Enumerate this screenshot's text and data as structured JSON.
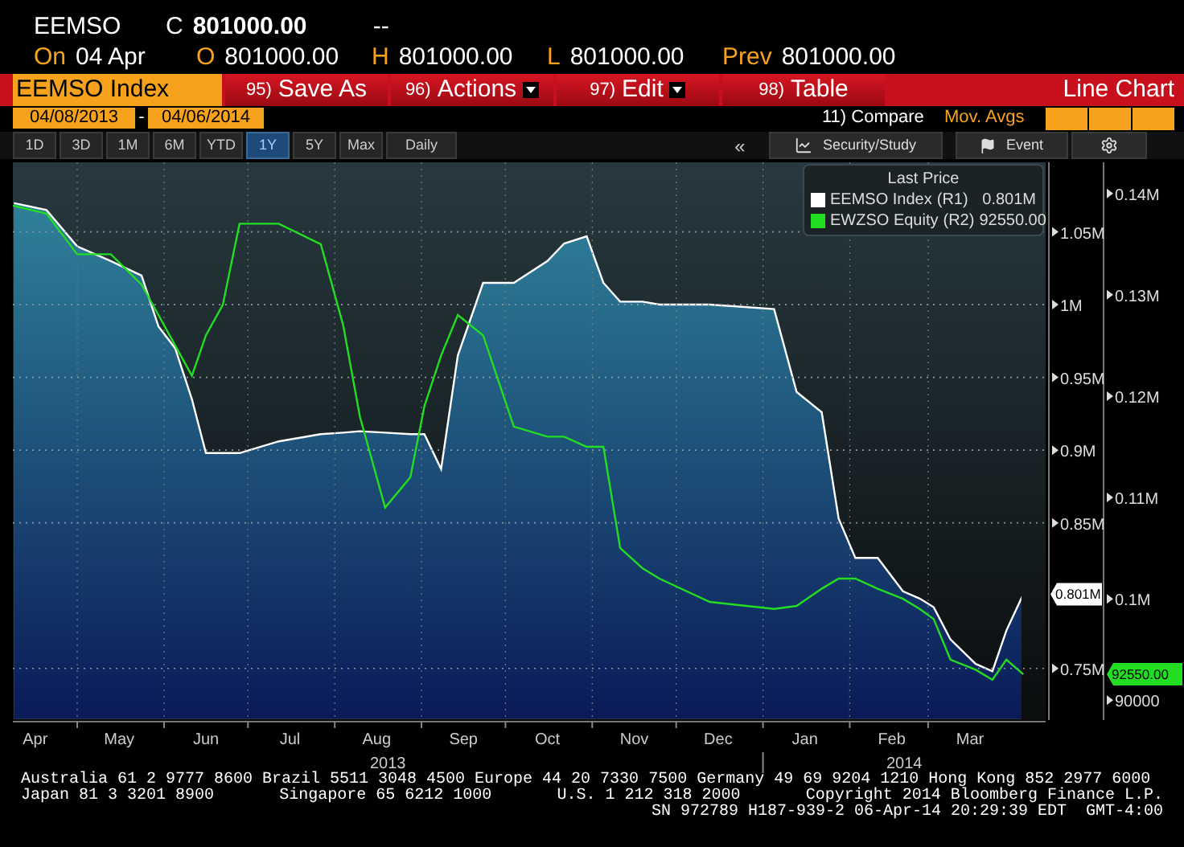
{
  "quote": {
    "ticker": "EEMSO",
    "close_label": "C",
    "close": "801000.00",
    "change": "--",
    "fields": [
      {
        "label": "On",
        "value": "04 Apr"
      },
      {
        "label": "O",
        "value": "801000.00"
      },
      {
        "label": "H",
        "value": "801000.00"
      },
      {
        "label": "L",
        "value": "801000.00"
      },
      {
        "label": "Prev",
        "value": "801000.00"
      }
    ]
  },
  "toolbar": {
    "security": "EEMSO Index",
    "buttons": [
      {
        "number": "95)",
        "label": "Save As",
        "dropdown": false
      },
      {
        "number": "96)",
        "label": "Actions",
        "dropdown": true
      },
      {
        "number": "97)",
        "label": "Edit",
        "dropdown": true
      },
      {
        "number": "98)",
        "label": "Table",
        "dropdown": false
      }
    ],
    "view": "Line Chart"
  },
  "range": {
    "start": "04/08/2013",
    "separator": "-",
    "end": "04/06/2014",
    "compare": "11) Compare",
    "mov_avgs": "Mov. Avgs"
  },
  "periods": [
    {
      "label": "1D",
      "selected": false
    },
    {
      "label": "3D",
      "selected": false
    },
    {
      "label": "1M",
      "selected": false
    },
    {
      "label": "6M",
      "selected": false
    },
    {
      "label": "YTD",
      "selected": false
    },
    {
      "label": "1Y",
      "selected": true
    },
    {
      "label": "5Y",
      "selected": false
    },
    {
      "label": "Max",
      "selected": false
    }
  ],
  "frequency": "Daily",
  "collapse": "«",
  "tools": [
    {
      "kind": "study",
      "label": "Security/Study"
    },
    {
      "kind": "event",
      "label": "Event"
    },
    {
      "kind": "settings"
    }
  ],
  "chart": {
    "legend": {
      "title": "Last Price",
      "items": [
        {
          "axis": "(R1)",
          "value": "0.801M"
        },
        {
          "axis": "(R2)",
          "value": "92550.00"
        }
      ]
    },
    "value_tags": [
      "0.801M",
      "92550.00"
    ],
    "year_labels": [
      "2013",
      "2014"
    ],
    "chart_data": {
      "type": "area",
      "grid": true,
      "xlim": [
        "2013-04-08",
        "2014-04-12"
      ],
      "legend": true,
      "x": [
        "2013-04-08",
        "2013-04-20",
        "2013-05-01",
        "2013-05-13",
        "2013-05-24",
        "2013-05-30",
        "2013-06-05",
        "2013-06-11",
        "2013-06-16",
        "2013-06-22",
        "2013-06-28",
        "2013-07-12",
        "2013-07-27",
        "2013-08-04",
        "2013-08-10",
        "2013-08-19",
        "2013-08-28",
        "2013-09-02",
        "2013-09-08",
        "2013-09-14",
        "2013-09-23",
        "2013-10-04",
        "2013-10-16",
        "2013-10-22",
        "2013-10-30",
        "2013-11-05",
        "2013-11-11",
        "2013-11-19",
        "2013-11-25",
        "2013-12-13",
        "2014-01-05",
        "2014-01-13",
        "2014-01-22",
        "2014-01-28",
        "2014-02-03",
        "2014-02-11",
        "2014-02-20",
        "2014-02-26",
        "2014-03-03",
        "2014-03-09",
        "2014-03-18",
        "2014-03-24",
        "2014-03-29",
        "2014-04-04"
      ],
      "series": [
        {
          "name": "EEMSO Index",
          "color": "#ffffff",
          "values": [
            1070000,
            1065000,
            1040000,
            1030000,
            1020000,
            985000,
            970000,
            935000,
            898000,
            898000,
            898000,
            906000,
            911000,
            912000,
            913000,
            912000,
            911000,
            911000,
            887000,
            965000,
            1015000,
            1015000,
            1030000,
            1042000,
            1047000,
            1015000,
            1002000,
            1002000,
            1000000,
            1000000,
            997000,
            940000,
            926000,
            853000,
            826000,
            826000,
            803000,
            798000,
            792000,
            770000,
            753000,
            748000,
            776000,
            801000
          ]
        },
        {
          "name": "EWZSO Equity",
          "color": "#22dd22",
          "axis": "y2",
          "type": "line",
          "values": [
            138800,
            138000,
            134000,
            134000,
            131000,
            128000,
            125000,
            122000,
            126000,
            129000,
            137000,
            137000,
            135000,
            127000,
            118000,
            109000,
            112000,
            119000,
            124000,
            128000,
            126000,
            117000,
            116000,
            116000,
            115000,
            115000,
            105000,
            103000,
            102000,
            99700,
            99000,
            99300,
            101000,
            102000,
            102000,
            101000,
            100000,
            99000,
            98000,
            94000,
            93000,
            92000,
            94000,
            92550
          ]
        }
      ],
      "ylim": [
        714500,
        1097800
      ],
      "yticks": [
        {
          "value": 1050000,
          "label": "1.05M"
        },
        {
          "value": 1000000,
          "label": "1M"
        },
        {
          "value": 950000,
          "label": "0.95M"
        },
        {
          "value": 900000,
          "label": "0.9M"
        },
        {
          "value": 850000,
          "label": "0.85M"
        },
        {
          "value": 750000,
          "label": "0.75M"
        }
      ],
      "y2lim": [
        88040,
        143065
      ],
      "y2ticks": [
        {
          "value": 140000,
          "label": "0.14M"
        },
        {
          "value": 130000,
          "label": "0.13M"
        },
        {
          "value": 120000,
          "label": "0.12M"
        },
        {
          "value": 110000,
          "label": "0.11M"
        },
        {
          "value": 100000,
          "label": "0.1M"
        },
        {
          "value": 90000,
          "label": "90000"
        }
      ],
      "xticks": [
        {
          "value": "2013-04-16",
          "label": "Apr"
        },
        {
          "value": "2013-05-16",
          "label": "May"
        },
        {
          "value": "2013-06-16",
          "label": "Jun"
        },
        {
          "value": "2013-07-16",
          "label": "Jul"
        },
        {
          "value": "2013-08-16",
          "label": "Aug"
        },
        {
          "value": "2013-09-16",
          "label": "Sep"
        },
        {
          "value": "2013-10-16",
          "label": "Oct"
        },
        {
          "value": "2013-11-16",
          "label": "Nov"
        },
        {
          "value": "2013-12-16",
          "label": "Dec"
        },
        {
          "value": "2014-01-16",
          "label": "Jan"
        },
        {
          "value": "2014-02-16",
          "label": "Feb"
        },
        {
          "value": "2014-03-16",
          "label": "Mar"
        }
      ]
    }
  },
  "footer": {
    "line_1": "Australia 61 2 9777 8600 Brazil 5511 3048 4500 Europe 44 20 7330 7500 Germany 49 69 9204 1210 Hong Kong 852 2977 6000",
    "line_2": [
      "Japan 81 3 3201 8900",
      "Singapore 65 6212 1000",
      "U.S. 1 212 318 2000",
      "Copyright 2014 Bloomberg Finance L.P."
    ],
    "line_3": "SN 972789 H187-939-2 06-Apr-14 20:29:39 EDT  GMT-4:00"
  }
}
